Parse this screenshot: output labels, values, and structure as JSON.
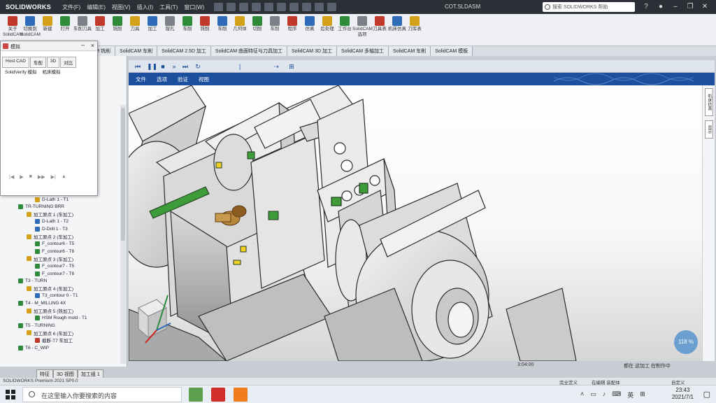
{
  "titlebar": {
    "app_name": "SOLIDWORKS",
    "menu": [
      "文件(F)",
      "编辑(E)",
      "视图(V)",
      "插入(I)",
      "工具(T)",
      "窗口(W)"
    ],
    "document": "COT.SLDASM",
    "search_placeholder": "搜索 SOLIDWORKS 帮助"
  },
  "ribbon": {
    "buttons": [
      "关于SolidCAM",
      "切换到SolidCAM",
      "新建",
      "打开",
      "车削刀具",
      "加工",
      "铣削",
      "刀具",
      "加工",
      "镗孔",
      "车削",
      "铣削",
      "车削",
      "几何体",
      "切削",
      "车削",
      "程序",
      "仿真",
      "后处理",
      "工作台",
      "SolidCAM选项",
      "刀具表",
      "机床仿真",
      "刀库表"
    ],
    "colors": [
      "#c0392b",
      "#2e6bb8",
      "#d4a017",
      "#2e8b3a",
      "#7a7f88",
      "#c0392b",
      "#2e8b3a",
      "#d4a017",
      "#2e6bb8",
      "#7a7f88",
      "#2e8b3a",
      "#c0392b",
      "#2e6bb8",
      "#d4a017",
      "#2e8b3a",
      "#7a7f88",
      "#c0392b",
      "#2e6bb8",
      "#d4a017",
      "#2e8b3a",
      "#7a7f88",
      "#c0392b",
      "#2e6bb8",
      "#d4a017"
    ]
  },
  "doctabs": [
    "SOLIDWORKS 插件",
    "MBD",
    "SolidCAM 铣削",
    "SolidCAM 车削",
    "SolidCAM 2.5D 加工",
    "SolidCAM 曲面特征与刀具加工",
    "SolidCAM 3D 加工",
    "SolidCAM 多轴加工",
    "SolidCAM 车削",
    "SolidCAM 模板"
  ],
  "dialog": {
    "title": "模拟",
    "tabs": [
      "Host CAD",
      "车削",
      "3D",
      "对比"
    ],
    "tabs2": [
      "SolidVerify 模拟",
      "机床模拟"
    ],
    "playback": [
      "|◀",
      "▶",
      "■",
      "▶▶",
      "▶|",
      "▲"
    ]
  },
  "tree": [
    {
      "label": "D-Lath 1 - T1",
      "indent": 50,
      "color": "#d4a017"
    },
    {
      "label": "TR-TURNING BRR",
      "indent": 26,
      "color": "#2e8b3a"
    },
    {
      "label": "加工原点 1 (车加工)",
      "indent": 38,
      "color": "#d4a017"
    },
    {
      "label": "D-Lath 1 - T2",
      "indent": 50,
      "color": "#2e6bb8"
    },
    {
      "label": "D-Drill 1 - T3",
      "indent": 50,
      "color": "#2e6bb8"
    },
    {
      "label": "加工原点 2 (车加工)",
      "indent": 38,
      "color": "#d4a017"
    },
    {
      "label": "F_contour6 - T5",
      "indent": 50,
      "color": "#2e8b3a"
    },
    {
      "label": "F_contour6 - T6",
      "indent": 50,
      "color": "#2e8b3a"
    },
    {
      "label": "加工原点 3 (车加工)",
      "indent": 38,
      "color": "#d4a017"
    },
    {
      "label": "F_contour7 - T5",
      "indent": 50,
      "color": "#2e8b3a"
    },
    {
      "label": "F_contour7 - T6",
      "indent": 50,
      "color": "#2e8b3a"
    },
    {
      "label": "T3 - TURN",
      "indent": 26,
      "color": "#2e8b3a"
    },
    {
      "label": "加工原点 4 (车加工)",
      "indent": 38,
      "color": "#d4a017"
    },
    {
      "label": "T3_contour 0 - T1",
      "indent": 50,
      "color": "#2e6bb8"
    },
    {
      "label": "T4 - M_MILLING 4X",
      "indent": 26,
      "color": "#2e8b3a"
    },
    {
      "label": "加工原点 5 (铣加工)",
      "indent": 38,
      "color": "#d4a017"
    },
    {
      "label": "HSM Rough mold - T1",
      "indent": 50,
      "color": "#2e8b3a"
    },
    {
      "label": "T5 - TURNING",
      "indent": 26,
      "color": "#2e8b3a"
    },
    {
      "label": "加工原点 6 (车加工)",
      "indent": 38,
      "color": "#d4a017"
    },
    {
      "label": "截断-T7 车加工",
      "indent": 50,
      "color": "#c0392b"
    },
    {
      "label": "T6 - C_WIP",
      "indent": 26,
      "color": "#2e8b3a"
    }
  ],
  "lefttabs": [
    "特征",
    "3D 视图",
    "加工组 1"
  ],
  "viewer": {
    "menu": [
      "文件",
      "选项",
      "验证",
      "视图"
    ],
    "right_tabs": [
      "机床仿真",
      "显示"
    ],
    "zoom_label": "118 %",
    "status_label": "3:04:00"
  },
  "status": {
    "left": "SOLIDWORKS Premium 2021 SP0.0",
    "right_a": "完全定义",
    "right_b": "在编辑 装配体",
    "right_c": "自定义"
  },
  "bottom_caption": "都在 这加工 在制作中",
  "taskbar": {
    "search_placeholder": "在这里输入你要搜索的内容",
    "ime": "英",
    "time": "23:43",
    "date": "2021/7/1"
  }
}
